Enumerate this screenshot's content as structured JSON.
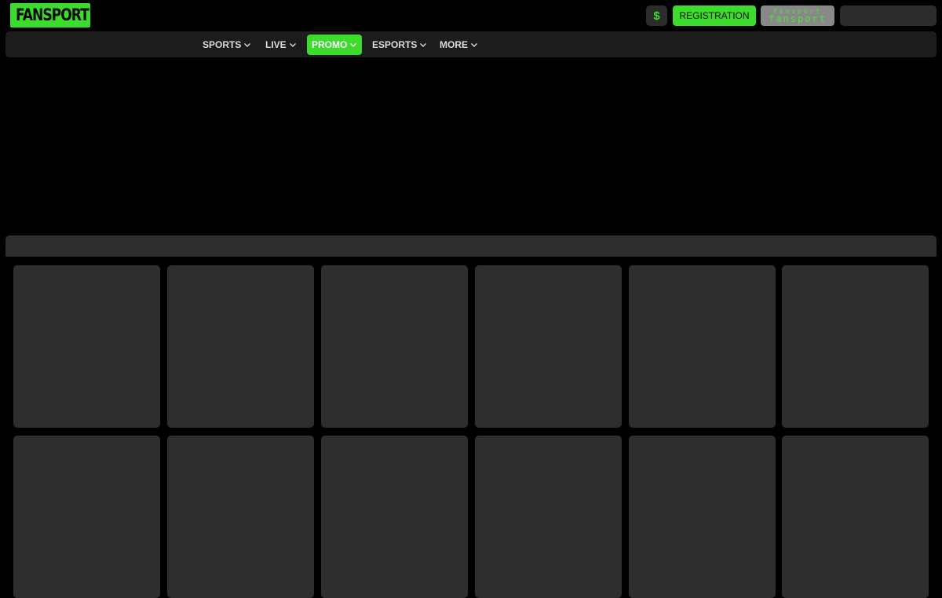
{
  "brand": {
    "logo_text": "FANSPORT",
    "accent_color": "#3bdc2c"
  },
  "header": {
    "currency_symbol": "$",
    "registration_label": "REGISTRATION",
    "login_logo_top": "fansport",
    "login_logo_bottom": "fansport",
    "search_placeholder": ""
  },
  "nav": {
    "items": [
      {
        "label": "SPORTS",
        "icon": "chevron-down-icon",
        "active": false
      },
      {
        "label": "LIVE",
        "icon": "chevron-down-icon",
        "active": false
      },
      {
        "label": "PROMO",
        "icon": "chevron-down-icon",
        "active": true
      },
      {
        "label": "ESPORTS",
        "icon": "chevron-down-icon",
        "active": false
      },
      {
        "label": "MORE",
        "icon": "chevron-down-icon",
        "active": false
      }
    ]
  }
}
